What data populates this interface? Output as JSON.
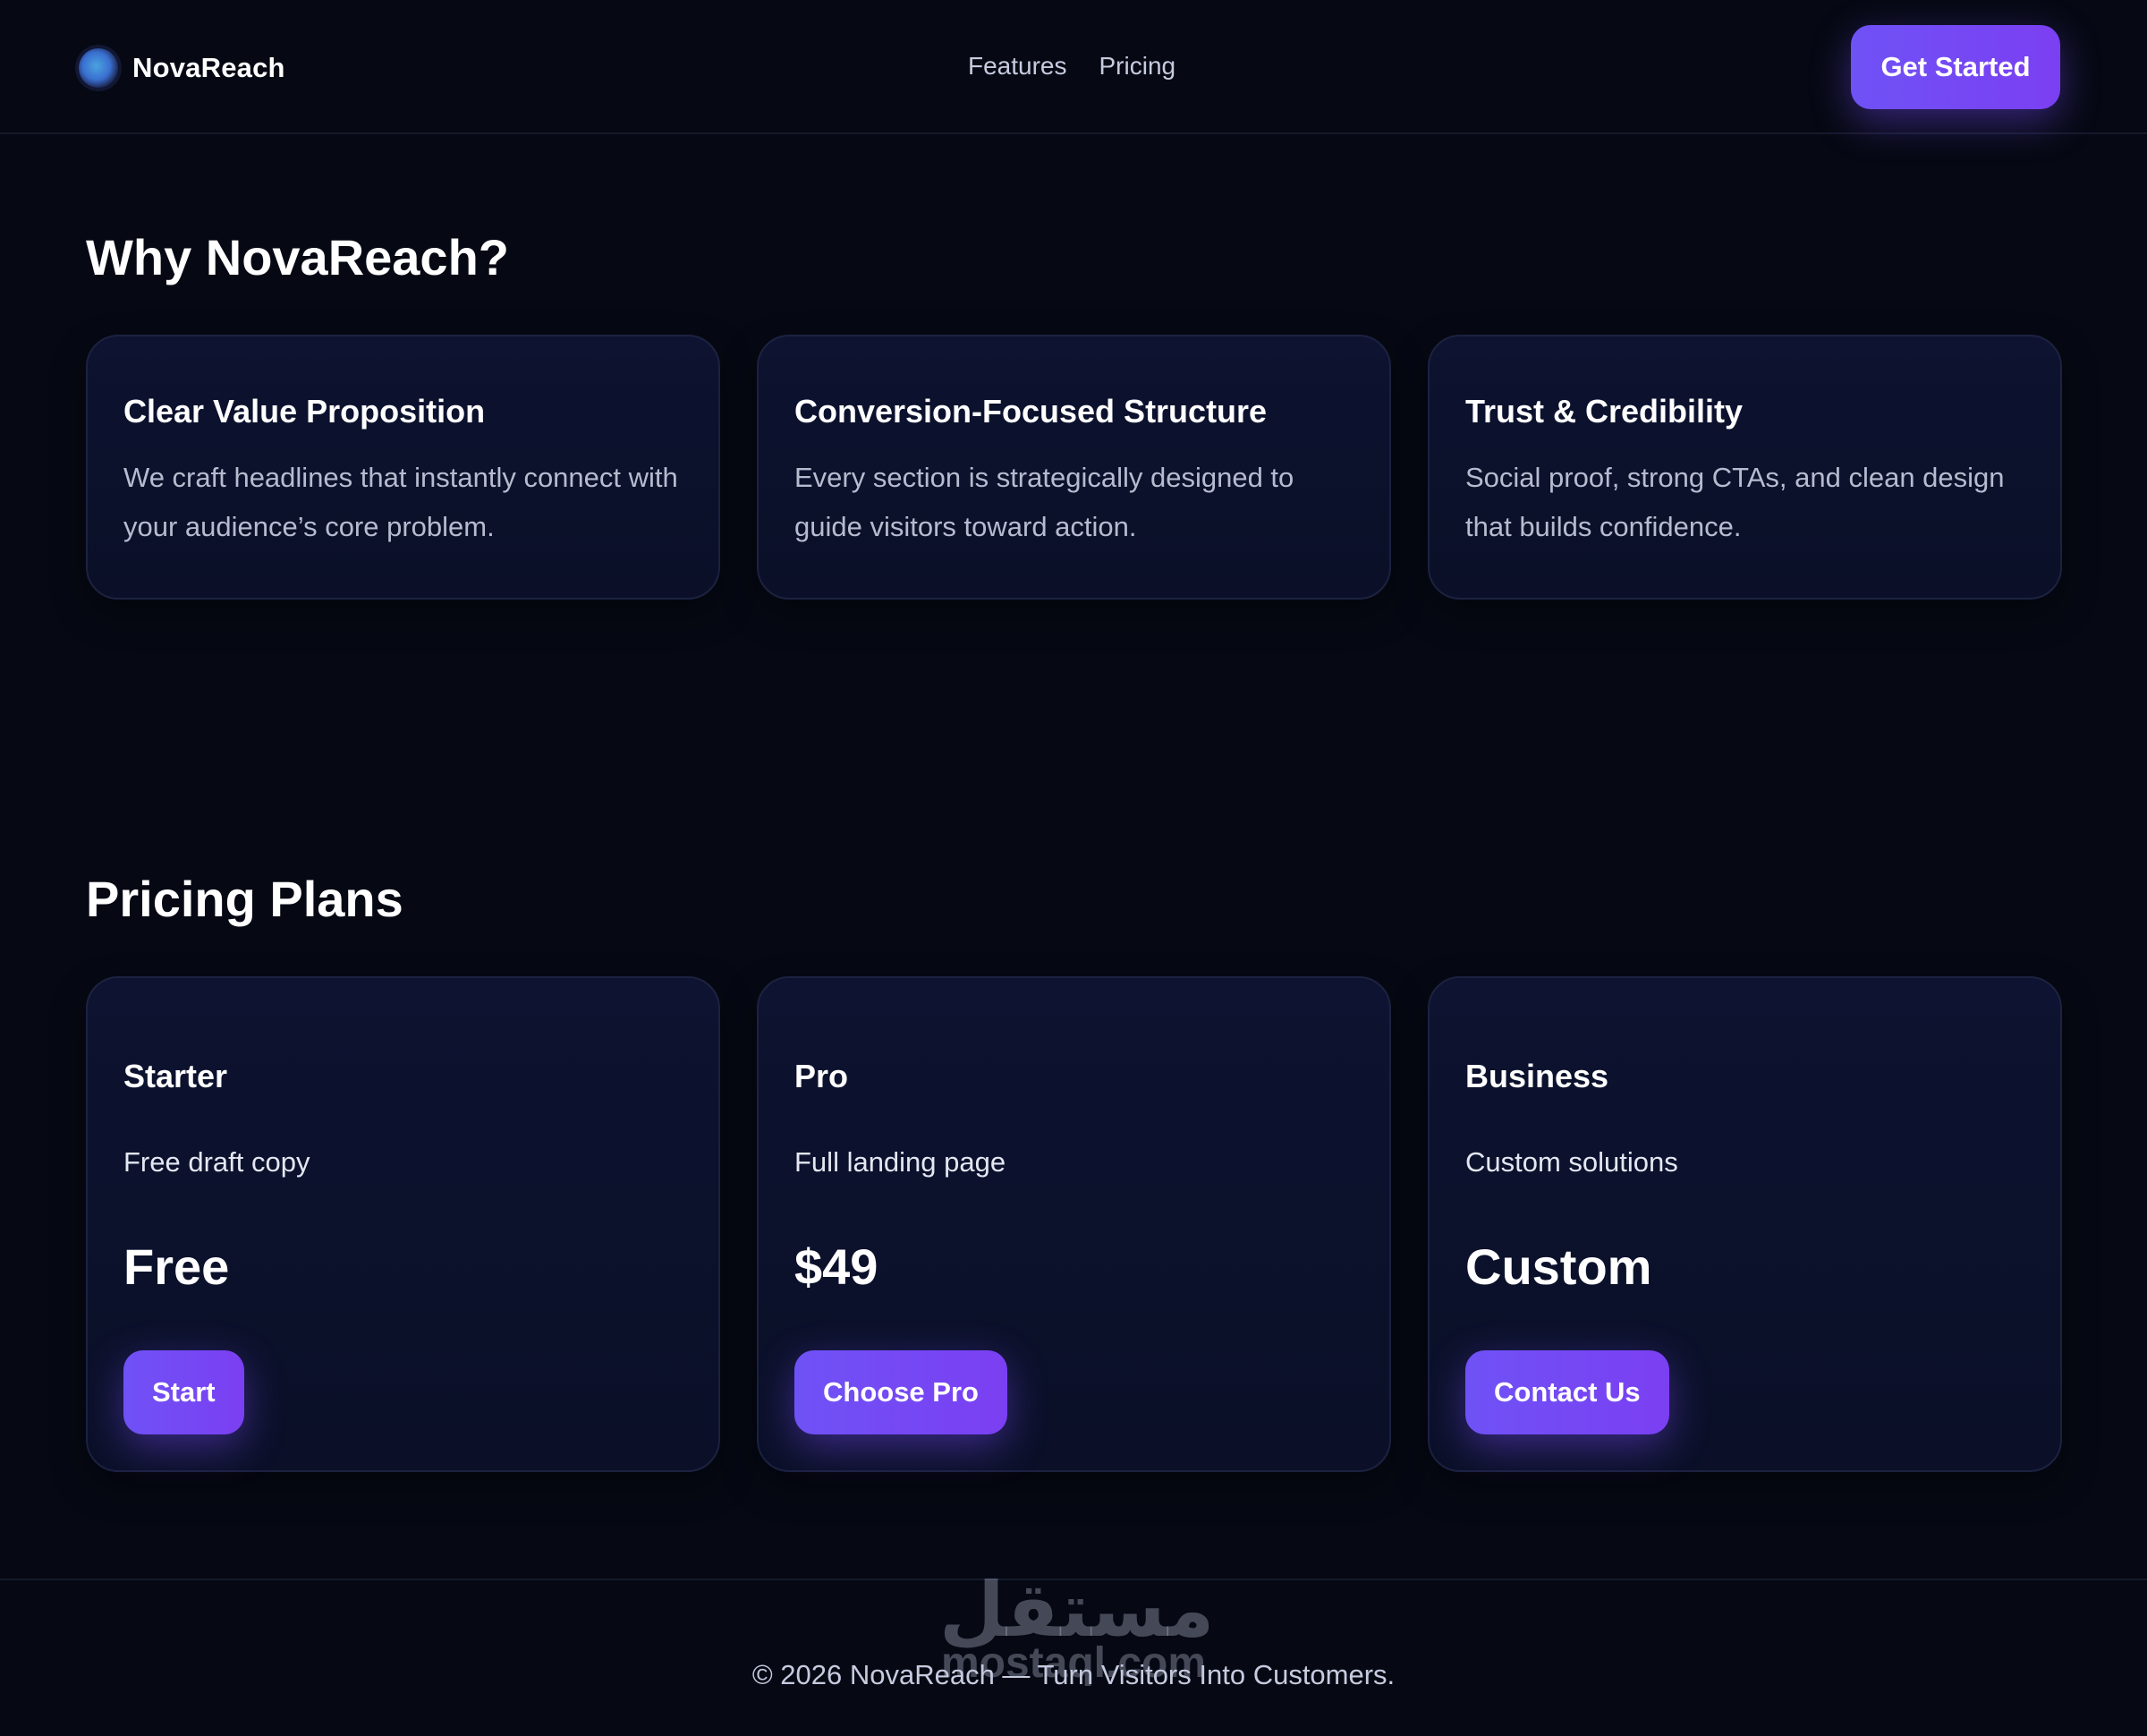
{
  "header": {
    "brand_name": "NovaReach",
    "brand_icon": "orb-logo-icon",
    "nav": [
      "Features",
      "Pricing"
    ],
    "cta_label": "Get Started"
  },
  "features": {
    "title": "Why NovaReach?",
    "cards": [
      {
        "title": "Clear Value Proposition",
        "desc": "We craft headlines that instantly connect with your audience’s core problem."
      },
      {
        "title": "Conversion-Focused Structure",
        "desc": "Every section is strategically designed to guide visitors toward action."
      },
      {
        "title": "Trust & Credibility",
        "desc": "Social proof, strong CTAs, and clean design that builds confidence."
      }
    ]
  },
  "pricing": {
    "title": "Pricing Plans",
    "plans": [
      {
        "name": "Starter",
        "desc": "Free draft copy",
        "price": "Free",
        "button": "Start"
      },
      {
        "name": "Pro",
        "desc": "Full landing page",
        "price": "$49",
        "button": "Choose Pro"
      },
      {
        "name": "Business",
        "desc": "Custom solutions",
        "price": "Custom",
        "button": "Contact Us"
      }
    ]
  },
  "footer": {
    "text": "© 2026 NovaReach — Turn Visitors Into Customers."
  },
  "watermark": {
    "arabic": "مستقل",
    "latin": "mostaql.com"
  },
  "colors": {
    "background": "#060913",
    "card": "#0d1330",
    "accent_start": "#6f52f6",
    "accent_end": "#7b3ff2"
  }
}
